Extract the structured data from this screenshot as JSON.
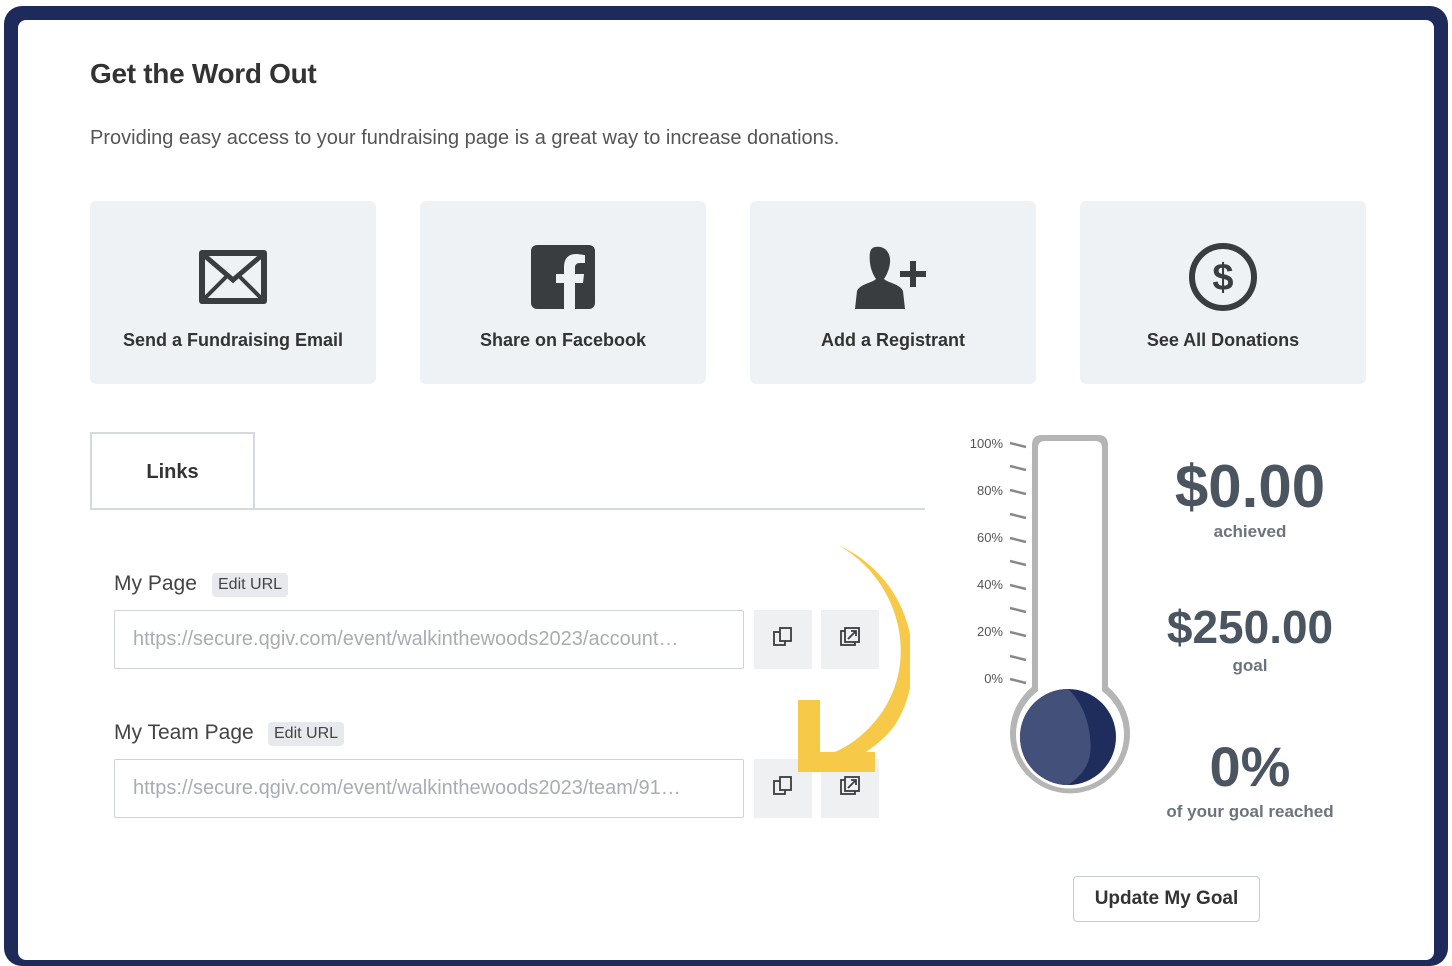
{
  "header": {
    "title": "Get the Word Out",
    "subtitle": "Providing easy access to your fundraising page is a great way to increase donations."
  },
  "actions": [
    {
      "label": "Send a Fundraising Email",
      "icon": "envelope-icon"
    },
    {
      "label": "Share on Facebook",
      "icon": "facebook-icon"
    },
    {
      "label": "Add a Registrant",
      "icon": "add-user-icon"
    },
    {
      "label": "See All Donations",
      "icon": "dollar-circle-icon"
    }
  ],
  "tabs": {
    "links": "Links"
  },
  "links": {
    "my_page": {
      "label": "My Page",
      "edit": "Edit URL",
      "url": "https://secure.qgiv.com/event/walkinthewoods2023/account…"
    },
    "my_team_page": {
      "label": "My Team Page",
      "edit": "Edit URL",
      "url": "https://secure.qgiv.com/event/walkinthewoods2023/team/91…"
    }
  },
  "thermometer": {
    "ticks": [
      "100%",
      "80%",
      "60%",
      "40%",
      "20%",
      "0%"
    ],
    "fill_fraction": 0
  },
  "stats": {
    "achieved_value": "$0.00",
    "achieved_label": "achieved",
    "goal_value": "$250.00",
    "goal_label": "goal",
    "percent_value": "0%",
    "percent_label": "of your goal reached"
  },
  "goal_button": "Update My Goal",
  "colors": {
    "frame": "#1e2a5a",
    "card_bg": "#eff2f5",
    "bulb": "#1f2d5c",
    "arrow": "#f7c948"
  }
}
